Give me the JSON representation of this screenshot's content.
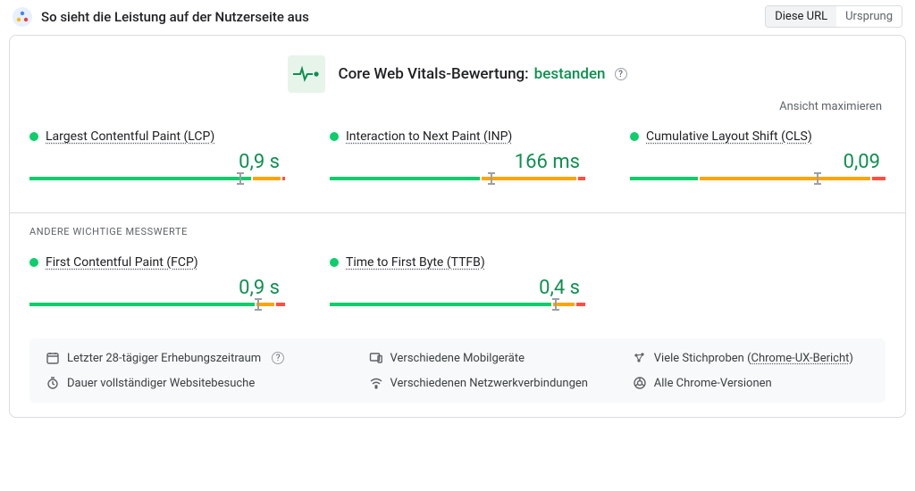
{
  "header": {
    "title": "So sieht die Leistung auf der Nutzerseite aus",
    "toggle": {
      "url": "Diese URL",
      "origin": "Ursprung"
    }
  },
  "assessment": {
    "label": "Core Web Vitals-Bewertung:",
    "status": "bestanden"
  },
  "maximize": "Ansicht maximieren",
  "metrics": [
    {
      "name": "Largest Contentful Paint (LCP)",
      "value": "0,9 s",
      "dist": {
        "g": 72,
        "o": 9,
        "r": 1
      },
      "marker": 82
    },
    {
      "name": "Interaction to Next Paint (INP)",
      "value": "166 ms",
      "dist": {
        "g": 22,
        "o": 14,
        "r": 1
      },
      "marker": 63
    },
    {
      "name": "Cumulative Layout Shift (CLS)",
      "value": "0,09",
      "dist": {
        "g": 10,
        "o": 25,
        "r": 2
      },
      "marker": 73
    }
  ],
  "secondary_label": "ANDERE WICHTIGE MESSWERTE",
  "secondary": [
    {
      "name": "First Contentful Paint (FCP)",
      "value": "0,9 s",
      "dist": {
        "g": 75,
        "o": 6,
        "r": 3
      },
      "marker": 89
    },
    {
      "name": "Time to First Byte (TTFB)",
      "value": "0,4 s",
      "dist": {
        "g": 74,
        "o": 7,
        "r": 3
      },
      "marker": 88
    }
  ],
  "footer": {
    "period": "Letzter 28-tägiger Erhebungszeitraum",
    "devices": "Verschiedene Mobilgeräte",
    "samples_prefix": "Viele Stichproben",
    "samples_link": "Chrome-UX-Bericht",
    "visit": "Dauer vollständiger Websitebesuche",
    "network": "Verschiedenen Netzwerkverbindungen",
    "chrome": "Alle Chrome-Versionen"
  }
}
